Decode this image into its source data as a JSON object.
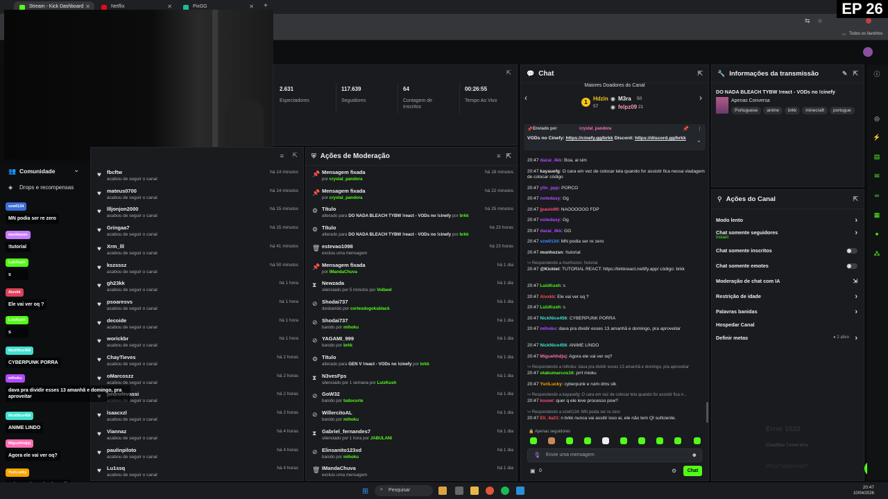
{
  "browser": {
    "tabs": [
      {
        "label": "Stream - Kick Dashboard",
        "color": "#53fc18"
      },
      {
        "label": "Netflix",
        "color": "#e50914"
      },
      {
        "label": "PixGG",
        "color": "#1abc9c"
      }
    ],
    "bookmarks_label": "Todos os favoritos"
  },
  "overlay": {
    "episode": "EP 26",
    "error_big": "Error 1033",
    "error_small": "Cloudflare Tunnel error",
    "error_what": "What happened?"
  },
  "stats": {
    "viewers": {
      "value": "2.631",
      "label": "Espectadores"
    },
    "followers": {
      "value": "117.639",
      "label": "Seguidores"
    },
    "subs": {
      "value": "64",
      "label": "Contagem de Inscritos"
    },
    "live_time": {
      "value": "00:26:55",
      "label": "Tempo Ao Vivo"
    }
  },
  "community": {
    "title": "Comunidade",
    "drops": "Drops e recompensas"
  },
  "followers_list": [
    {
      "name": "fbcftw",
      "action": "acabou de seguir o canal",
      "time": "há 14 minutos"
    },
    {
      "name": "mateus0700",
      "action": "acabou de seguir o canal",
      "time": "há 14 minutos"
    },
    {
      "name": "llljonjon2000",
      "action": "acabou de seguir o canal",
      "time": "há 15 minutos"
    },
    {
      "name": "Gringaa7",
      "action": "acabou de seguir o canal",
      "time": "há 15 minutos"
    },
    {
      "name": "Xrm_lll",
      "action": "acabou de seguir o canal",
      "time": "há 41 minutos"
    },
    {
      "name": "kszsssz",
      "action": "acabou de seguir o canal",
      "time": "há 50 minutos"
    },
    {
      "name": "gh23kk",
      "action": "acabou de seguir o canal",
      "time": "há 1 hora"
    },
    {
      "name": "psoaresvs",
      "action": "acabou de seguir o canal",
      "time": "há 1 hora"
    },
    {
      "name": "decoide",
      "action": "acabou de seguir o canal",
      "time": "há 1 hora"
    },
    {
      "name": "worickbr",
      "action": "acabou de seguir o canal",
      "time": "há 1 hora"
    },
    {
      "name": "ChayTieves",
      "action": "acabou de seguir o canal",
      "time": "há 2 horas"
    },
    {
      "name": "oMarcoszz",
      "action": "acabou de seguir o canal",
      "time": "há 2 horas"
    },
    {
      "name": "pedrofevassi",
      "action": "acabou de seguir o canal",
      "time": "há 2 horas"
    },
    {
      "name": "lsaacxzl",
      "action": "acabou de seguir o canal",
      "time": "há 2 horas"
    },
    {
      "name": "Viannaz",
      "action": "acabou de seguir o canal",
      "time": "há 4 horas"
    },
    {
      "name": "paulinpiloto",
      "action": "acabou de seguir o canal",
      "time": "há 4 horas"
    },
    {
      "name": "Lu1ssq",
      "action": "acabou de seguir o canal",
      "time": "há 4 horas"
    }
  ],
  "moderation": {
    "title": "Ações de Moderação",
    "rows": [
      {
        "icon": "📌",
        "title": "Mensagem fixada",
        "pre": "por ",
        "user": "crystal_pandora",
        "post": "",
        "time": "há 18 minutos"
      },
      {
        "icon": "📌",
        "title": "Mensagem fixada",
        "pre": "por ",
        "user": "crystal_pandora",
        "post": "",
        "time": "há 22 minutos"
      },
      {
        "icon": "⚙",
        "title": "Título",
        "pre": "alterado para ",
        "strong": "DO NADA BLEACH TYBW !react - VODs no !cinefy",
        "mid": " por ",
        "user": "brkk",
        "time": "há 25 minutos"
      },
      {
        "icon": "⚙",
        "title": "Título",
        "pre": "alterado para ",
        "strong": "DO NADA BLEACH TYBW !react - VODs no !cinefy",
        "mid": " por ",
        "user": "brkk",
        "time": "há 23 horas"
      },
      {
        "icon": "🗑",
        "title": "estevao1098",
        "pre": "excluiu uma mensagem",
        "user": "",
        "time": "há 23 horas"
      },
      {
        "icon": "📌",
        "title": "Mensagem fixada",
        "pre": "por ",
        "user": "IMandaChuva",
        "time": "há 1 dia"
      },
      {
        "icon": "⧗",
        "title": "Newzada",
        "pre": "silenciado por 5 minutos por ",
        "user": "Volbeel",
        "time": "há 1 dia"
      },
      {
        "icon": "⊘",
        "title": "Shodai737",
        "pre": "desbanido por ",
        "user": "cortesdogokublack",
        "time": "há 1 dia"
      },
      {
        "icon": "⊘",
        "title": "Shodai737",
        "pre": "banido por ",
        "user": "mihoku",
        "time": "há 1 dia"
      },
      {
        "icon": "⊘",
        "title": "YAGAMI_999",
        "pre": "banido por ",
        "user": "brkk",
        "time": "há 1 dia"
      },
      {
        "icon": "⚙",
        "title": "Título",
        "pre": "alterado para ",
        "strong": "GEN V !react - VODs no !cinefy",
        "mid": " por ",
        "user": "brkk",
        "time": "há 1 dia"
      },
      {
        "icon": "⧗",
        "title": "N3vesFps",
        "pre": "silenciado por 1 semana por ",
        "user": "LuizKush",
        "time": "há 1 dia"
      },
      {
        "icon": "⊘",
        "title": "GoW32",
        "pre": "banido por ",
        "user": "tudocorte",
        "time": "há 1 dia"
      },
      {
        "icon": "⊘",
        "title": "WillercitoAL",
        "pre": "banido por ",
        "user": "mihoku",
        "time": "há 1 dia"
      },
      {
        "icon": "⧗",
        "title": "Gabriel_fernandes7",
        "pre": "silenciado por 1 hora por ",
        "user": "JABULANI",
        "time": "há 1 dia"
      },
      {
        "icon": "⊘",
        "title": "Elinsanito123xd",
        "pre": "banido por ",
        "user": "mihoku",
        "time": "há 1 dia"
      },
      {
        "icon": "🗑",
        "title": "IMandaChuva",
        "pre": "excluiu uma mensagem",
        "user": "",
        "time": "há 1 dia"
      }
    ]
  },
  "chat": {
    "title": "Chat",
    "donors_title": "Maiores Doadores do Canal",
    "donors": [
      {
        "name": "Hdzin",
        "value": "57",
        "rank": "1"
      },
      {
        "name": "M3ra",
        "value": "50"
      },
      {
        "name": "felpz09",
        "value": "21"
      }
    ],
    "pinned": {
      "by": "Enviado por",
      "user": "crystal_pandora",
      "text": "VODs no Cinefy: ",
      "link1": "https://cinefy.gg/brkk",
      "mid": " Discord: ",
      "link2": "https://discord.gg/brkk"
    },
    "messages": [
      {
        "time": "20:47",
        "user": "dazai_4kk",
        "color": "#b14bff",
        "text": "Boa, ai sim"
      },
      {
        "time": "20:47",
        "user": "kayauefg",
        "color": "#e3e3e3",
        "text": "O cara em vez de colocar tela quando for assistir fica nessa viadagem de colocar código"
      },
      {
        "time": "20:47",
        "user": "ylin_ppp",
        "color": "#b14bff",
        "text": "PORCO"
      },
      {
        "time": "20:47",
        "user": "notedasy",
        "color": "#b14bff",
        "text": "Gg"
      },
      {
        "time": "20:47",
        "user": "jpaulo99",
        "color": "#ff4d7a",
        "text": "NAOOOOOO FDP"
      },
      {
        "time": "20:47",
        "user": "notedasy",
        "color": "#b14bff",
        "text": "Gg"
      },
      {
        "time": "20:47",
        "user": "dazai_4kk",
        "color": "#b14bff",
        "text": "GG"
      },
      {
        "time": "20:47",
        "user": "vzw0134",
        "color": "#3b8dff",
        "text": "MN podia ser re zero"
      },
      {
        "time": "20:47",
        "user": "munhozsn",
        "color": "#e3e3e3",
        "text": "!tutorial"
      },
      {
        "reply": "Respondendo a munhozsn: !tutorial"
      },
      {
        "time": "20:47",
        "user": "@Kicklet",
        "color": "#e3e3e3",
        "text": "TUTORIAL REACT: https://brkkreact.netlify.app/ código: brkk"
      },
      {
        "time": "20:47",
        "user": "LuizKush",
        "color": "#53fc18",
        "text": "s"
      },
      {
        "time": "20:47",
        "user": "Aivxkk",
        "color": "#ff4d4d",
        "text": "Ele vai ver oq ?"
      },
      {
        "time": "20:47",
        "user": "LuizKush",
        "color": "#53fc18",
        "text": "s"
      },
      {
        "time": "20:47",
        "user": "NickNice456",
        "color": "#40e0d0",
        "text": "CYBERPUNK PORRA"
      },
      {
        "time": "20:47",
        "user": "mihoku",
        "color": "#b14bff",
        "text": "dava pra dividir esses 13 amanhã e domingo, pra aproveitar"
      },
      {
        "time": "20:47",
        "user": "NickNice456",
        "color": "#40e0d0",
        "text": "ANIME LINDO"
      },
      {
        "time": "20:47",
        "user": "Miguehhdjsj",
        "color": "#ff6eb4",
        "text": "Agora ele vai ver oq?"
      },
      {
        "reply": "Respondendo a mihoku: dava pra dividir esses 13 amanhã e domingo, pra aproveitar"
      },
      {
        "time": "20:47",
        "user": "otakumarcos16",
        "color": "#53fc18",
        "text": "prrt mioku"
      },
      {
        "time": "20:47",
        "user": "YuriLucky",
        "color": "#ffa500",
        "text": "cyberpunk e ruim dms slk"
      },
      {
        "reply": "Respondendo a kayauefg: O cara em vez de colocar tela quando for assistir fica n..."
      },
      {
        "time": "20:47",
        "user": "kouwr",
        "color": "#ff4d7a",
        "text": "quer q ele leve processo pow?"
      },
      {
        "reply": "Respondendo a vzw0134: MN podia ser re zero"
      },
      {
        "time": "20:47",
        "user": "Eli_4a21",
        "color": "#ff4d4d",
        "text": "n brkk nunca vai assitir isso ai, ele não tem QI suficiente."
      }
    ],
    "followers_only": "Apenas seguidores",
    "input_placeholder": "Envie uma mensagem",
    "count": "0",
    "send_label": "Chat"
  },
  "stream_info": {
    "title": "Informações da transmissão",
    "stream_title": "DO NADA BLEACH TYBW !react - VODs no !cinefy",
    "category": "Apenas Conversa",
    "tags": [
      "Portuguese",
      "anime",
      "brkk",
      "minecraft",
      "portugue"
    ]
  },
  "channel_actions": {
    "title": "Ações do Canal",
    "items": [
      {
        "label": "Modo lento",
        "kind": "arrow"
      },
      {
        "label": "Chat somente seguidores",
        "sub": "Instant",
        "kind": "arrow"
      },
      {
        "label": "Chat somente inscritos",
        "kind": "toggle"
      },
      {
        "label": "Chat somente emotes",
        "kind": "toggle"
      },
      {
        "label": "Moderação de chat com IA",
        "kind": "ext"
      },
      {
        "label": "Restrição de idade",
        "kind": "arrow"
      },
      {
        "label": "Palavras banidas",
        "kind": "arrow"
      },
      {
        "label": "Hospedar Canal",
        "kind": "none"
      },
      {
        "label": "Definir metas",
        "kind": "meta",
        "extra": "2 ativo"
      }
    ]
  },
  "overlay_chat": [
    {
      "user": "vzw0134",
      "color": "#3b6fd6",
      "text": "MN podia ser re zero"
    },
    {
      "user": "munhozsn",
      "color": "#c77dff",
      "text": "!tutorial"
    },
    {
      "user": "LuizKush",
      "color": "#53fc18",
      "text": "s"
    },
    {
      "user": "Aivxkk",
      "color": "#e0405a",
      "text": "Ele vai ver oq ?"
    },
    {
      "user": "LuizKush",
      "color": "#53fc18",
      "text": "s"
    },
    {
      "user": "NickNice456",
      "color": "#40e0d0",
      "text": "CYBERPUNK PORRA"
    },
    {
      "user": "mihoku",
      "color": "#b14bff",
      "text": "dava pra dividir esses 13 amanhã e domingo, pra aproveitar"
    },
    {
      "user": "NickNice456",
      "color": "#40e0d0",
      "text": "ANIME LINDO"
    },
    {
      "user": "Miguehhdjsj",
      "color": "#ff6eb4",
      "text": "Agora ele vai ver oq?"
    },
    {
      "user": "YuriLucky",
      "color": "#ffa500",
      "text": "cyberpunk e ruim dms slk"
    }
  ],
  "taskbar": {
    "search": "Pesquisar",
    "time": "20:47",
    "date": "10/04/2026"
  }
}
